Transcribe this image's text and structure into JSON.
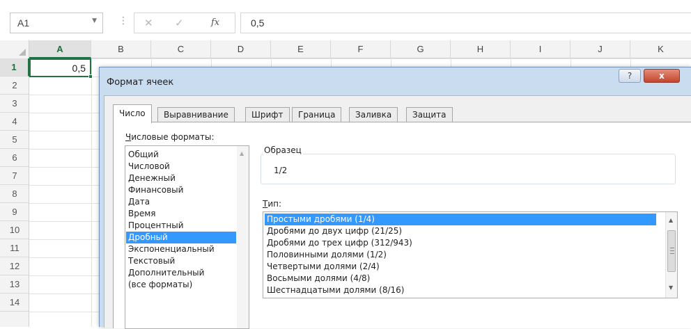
{
  "formula_bar": {
    "namebox": "A1",
    "namebox_dropdown_icon": "chevron-down-icon",
    "separator": "⋮",
    "cancel_glyph": "✕",
    "enter_glyph": "✓",
    "fx_label": "fx",
    "formula_value": "0,5"
  },
  "sheet": {
    "columns": [
      "A",
      "B",
      "C",
      "D",
      "E",
      "F",
      "G",
      "H",
      "I",
      "J",
      "K"
    ],
    "rows": [
      "1",
      "2",
      "3",
      "4",
      "5",
      "6",
      "7",
      "8",
      "9",
      "10",
      "11",
      "12",
      "13",
      "14"
    ],
    "active_cell_value": "0,5",
    "accent_color": "#217346"
  },
  "dialog": {
    "title": "Формат ячеек",
    "help_label": "?",
    "close_label": "x",
    "tabs": [
      "Число",
      "Выравнивание",
      "Шрифт",
      "Граница",
      "Заливка",
      "Защита"
    ],
    "active_tab": "Число",
    "categories_label_first": "Ч",
    "categories_label_rest": "исловые форматы:",
    "categories": [
      "Общий",
      "Числовой",
      "Денежный",
      "Финансовый",
      "Дата",
      "Время",
      "Процентный",
      "Дробный",
      "Экспоненциальный",
      "Текстовый",
      "Дополнительный",
      "(все форматы)"
    ],
    "selected_category": "Дробный",
    "sample_label": "Образец",
    "sample_value": "1/2",
    "type_label_first": "Т",
    "type_label_rest": "ип:",
    "types": [
      "Простыми дробями (1/4)",
      "Дробями до двух цифр (21/25)",
      "Дробями до трех цифр (312/943)",
      "Половинными долями (1/2)",
      "Четвертыми долями (2/4)",
      "Восьмыми долями (4/8)",
      "Шестнадцатыми долями (8/16)"
    ],
    "selected_type": "Простыми дробями (1/4)",
    "selection_color": "#3399ff"
  }
}
